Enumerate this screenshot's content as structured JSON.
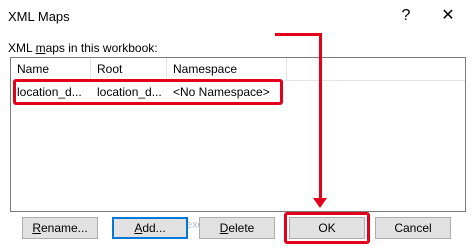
{
  "dialog": {
    "title": "XML Maps",
    "help_label": "?",
    "close_label": "✕"
  },
  "section_label": {
    "prefix": "XML ",
    "accel": "m",
    "suffix": "aps in this workbook:"
  },
  "table": {
    "columns": [
      "Name",
      "Root",
      "Namespace"
    ],
    "rows": [
      [
        "location_d...",
        "location_d...",
        "<No Namespace>"
      ]
    ]
  },
  "buttons": {
    "rename": {
      "accel": "R",
      "rest": "ename..."
    },
    "add": {
      "accel": "A",
      "rest": "dd..."
    },
    "delete": {
      "accel": "D",
      "rest": "elete"
    },
    "ok": "OK",
    "cancel": "Cancel"
  },
  "watermark": "exceldemy",
  "colors": {
    "annotation": "#e3001b",
    "focus": "#0078d7"
  }
}
